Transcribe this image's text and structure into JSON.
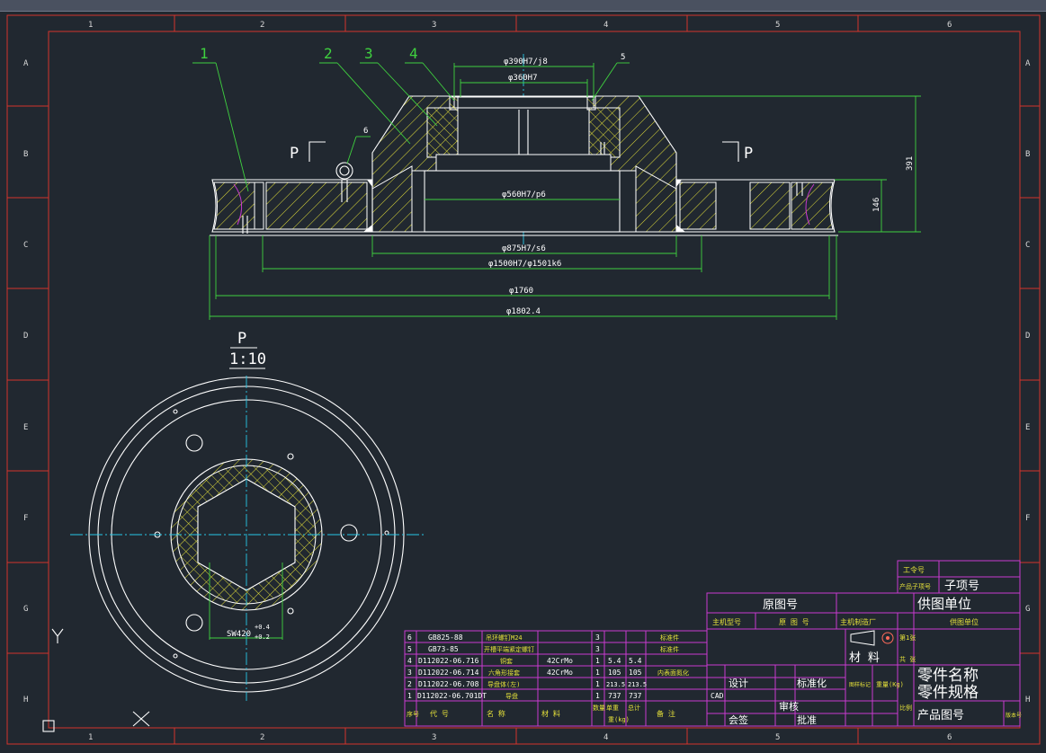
{
  "grid": {
    "columns": [
      "1",
      "2",
      "3",
      "4",
      "5",
      "6"
    ],
    "rows": [
      "A",
      "B",
      "C",
      "D",
      "E",
      "F",
      "G",
      "H"
    ]
  },
  "balloons": [
    "1",
    "2",
    "3",
    "4",
    "5",
    "6"
  ],
  "section": {
    "left_label": "P",
    "right_label": "P"
  },
  "view": {
    "title": "P",
    "scale": "1:10"
  },
  "dims": {
    "d390": "φ390H7/j8",
    "d360": "φ360H7",
    "d560": "φ560H7/p6",
    "d875": "φ875H7/s6",
    "d1500": "φ1500H7/φ1501k6",
    "d1760": "φ1760",
    "d1802": "φ1802.4",
    "h391": "391",
    "h146": "146",
    "sw": "SW420",
    "sw_tol_up": "+0.4",
    "sw_tol_dn": "+0.2"
  },
  "bom": [
    {
      "no": "6",
      "code": "GB825-88",
      "name": "吊环螺钉M24",
      "material": "",
      "qty": "3",
      "unit": "",
      "total": "",
      "note": "标准件"
    },
    {
      "no": "5",
      "code": "GB73-85",
      "name": "开槽平端紧定螺钉",
      "material": "",
      "qty": "3",
      "unit": "",
      "total": "",
      "note": "标准件"
    },
    {
      "no": "4",
      "code": "D112022-06.716",
      "name": "铜套",
      "material": "42CrMo",
      "qty": "1",
      "unit": "5.4",
      "total": "5.4",
      "note": ""
    },
    {
      "no": "3",
      "code": "D112022-06.714",
      "name": "六角形接套",
      "material": "42CrMo",
      "qty": "1",
      "unit": "105",
      "total": "105",
      "note": "内表面氮化"
    },
    {
      "no": "2",
      "code": "D112022-06.708",
      "name": "导盘体(左)",
      "material": "",
      "qty": "1",
      "unit": "213.5",
      "total": "213.5",
      "note": ""
    },
    {
      "no": "1",
      "code": "D112022-06.701DT",
      "name": "导盘",
      "material": "",
      "qty": "1",
      "unit": "737",
      "total": "737",
      "note": ""
    }
  ],
  "bom_header": {
    "no": "序号",
    "code": "代  号",
    "name": "名  称",
    "material": "材  料",
    "qty": "数量",
    "unit": "单重",
    "total": "总计",
    "weight": "重(kg)",
    "note": "备  注"
  },
  "title_block": {
    "work_no": "工令号",
    "product_sub": "产品子项号",
    "sub_value": "子项号",
    "orig_drawing": "原图号",
    "supplier": "供图单位",
    "main_model": "主机型号",
    "orig_no": "原 图 号",
    "main_maker": "主机制造厂",
    "supplier_label": "供图单位",
    "part_name": "零件名称",
    "part_spec": "零件规格",
    "product_drawing": "产品图号",
    "material": "材  料",
    "design": "设计",
    "standard": "标准化",
    "cad": "CAD",
    "review": "审核",
    "approve": "批准",
    "countersign": "会签",
    "weight": "重量(Kg)",
    "scale": "比例",
    "sheet": "第1张",
    "version": "版本号",
    "drawing_mark": "图样标记",
    "total_sheets": "共 张"
  },
  "colors": {
    "background": "#212830",
    "border": "#d4342c",
    "outline": "#ffffff",
    "dimension": "#3fd13f",
    "center": "#28c8e8",
    "hatch": "#e5e13a",
    "table": "#c93ad0"
  }
}
